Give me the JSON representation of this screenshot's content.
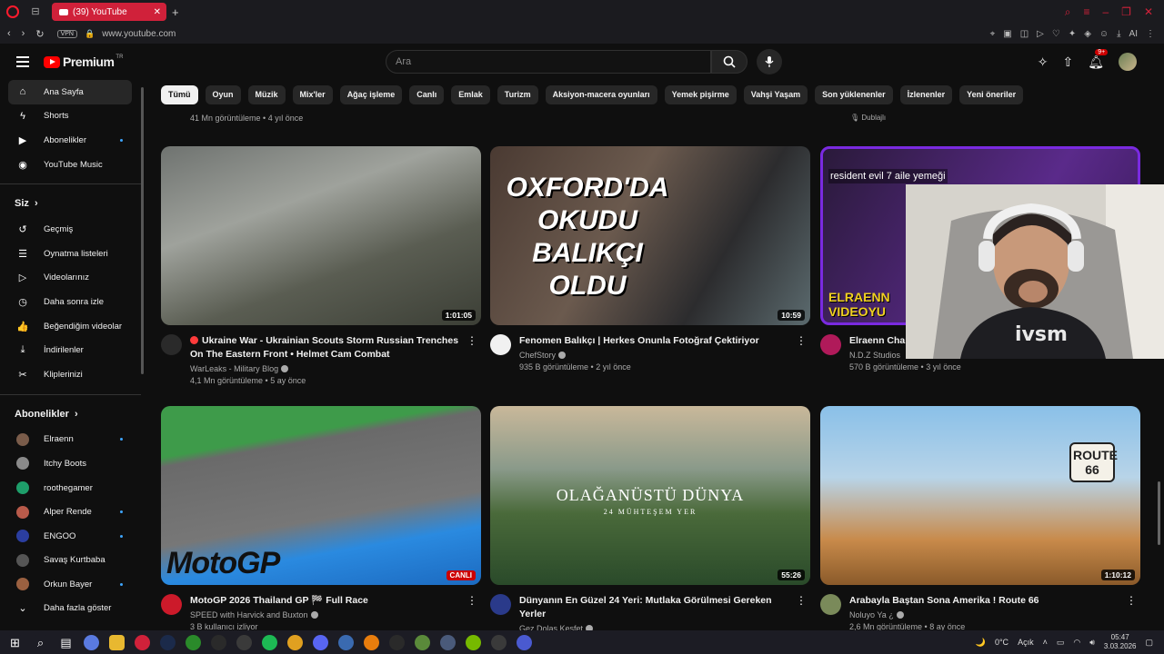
{
  "browser": {
    "tab_title": "(39) YouTube",
    "url": "www.youtube.com",
    "vpn_label": "VPN",
    "ai_label": "AI"
  },
  "header": {
    "logo_text": "Premium",
    "logo_region": "TR",
    "search_placeholder": "Ara",
    "notification_count": "9+"
  },
  "sidebar": {
    "main_items": [
      {
        "label": "Ana Sayfa",
        "icon": "home-icon",
        "glyph": "⌂"
      },
      {
        "label": "Shorts",
        "icon": "shorts-icon",
        "glyph": "ϟ"
      },
      {
        "label": "Abonelikler",
        "icon": "subscriptions-icon",
        "glyph": "▶"
      },
      {
        "label": "YouTube Music",
        "icon": "music-icon",
        "glyph": "◉"
      }
    ],
    "you_heading": "Siz",
    "you_items": [
      {
        "label": "Geçmiş",
        "icon": "history-icon",
        "glyph": "↺"
      },
      {
        "label": "Oynatma listeleri",
        "icon": "playlists-icon",
        "glyph": "☰"
      },
      {
        "label": "Videolarınız",
        "icon": "your-videos-icon",
        "glyph": "▷"
      },
      {
        "label": "Daha sonra izle",
        "icon": "watch-later-icon",
        "glyph": "◷"
      },
      {
        "label": "Beğendiğim videolar",
        "icon": "liked-icon",
        "glyph": "👍"
      },
      {
        "label": "İndirilenler",
        "icon": "downloads-icon",
        "glyph": "⤓"
      },
      {
        "label": "Kliplerinizi",
        "icon": "clips-icon",
        "glyph": "✂"
      }
    ],
    "subs_heading": "Abonelikler",
    "channels": [
      {
        "name": "Elraenn",
        "color": "#7a5c4a",
        "dot": true
      },
      {
        "name": "Itchy Boots",
        "color": "#8a8a8a",
        "dot": false
      },
      {
        "name": "roothegamer",
        "color": "#1e9e6a",
        "dot": false
      },
      {
        "name": "Alper Rende",
        "color": "#b85a4a",
        "dot": true
      },
      {
        "name": "ENGOO",
        "color": "#2b3ea0",
        "dot": true
      },
      {
        "name": "Savaş Kurtbaba",
        "color": "#555555",
        "dot": false
      },
      {
        "name": "Orkun Bayer",
        "color": "#9a6040",
        "dot": true
      }
    ],
    "show_more": "Daha fazla göster"
  },
  "chips": [
    "Tümü",
    "Oyun",
    "Müzik",
    "Mix'ler",
    "Ağaç işleme",
    "Canlı",
    "Emlak",
    "Turizm",
    "Aksiyon-macera oyunları",
    "Yemek pişirme",
    "Vahşi Yaşam",
    "Son yüklenenler",
    "İzlenenler",
    "Yeni öneriler"
  ],
  "previous_row": {
    "meta": "41 Mn görüntüleme • 4 yıl önce",
    "dubbed": "Dublajlı"
  },
  "videos": [
    {
      "title": "Ukraine War - Ukrainian Scouts Storm Russian Trenches On The Eastern Front • Helmet Cam Combat",
      "channel": "WarLeaks - Military Blog",
      "meta": "4,1 Mn görüntüleme • 5 ay önce",
      "duration": "1:01:05",
      "thumb_bg": "linear-gradient(160deg,#6f7370 0%,#9fa29c 35%,#5a5d52 65%,#3c3f36 100%)",
      "icon_color": "#2a2a2a"
    },
    {
      "title": "Fenomen Balıkçı | Herkes Onunla Fotoğraf Çektiriyor",
      "channel": "ChefStory",
      "meta": "935 B görüntüleme • 2 yıl önce",
      "duration": "10:59",
      "thumb_bg": "linear-gradient(120deg,#4a3a32 0%,#6b5a4e 40%,#2c2c2e 70%,#5b6a6e 100%)",
      "thumb_text": "OXFORD'DA OKUDU BALIKÇI OLDU",
      "icon_color": "#f1f1f1"
    },
    {
      "title": "Elraenn Charlie Kesmesi ve Resident Evil 7 İzliyor | Cordy",
      "channel": "N.D.Z Studios",
      "meta": "570 B görüntüleme • 3 yıl önce",
      "thumb_bg": "linear-gradient(120deg,#2a1a3a 0%,#5a2a8a 60%,#3a1a5a 100%)",
      "thumb_text": "resident evil 7 aile yemeği",
      "thumb_text2": "ELRAENN VIDEOYU",
      "icon_color": "#b01a5a"
    },
    {
      "title": "MotoGP 2026 Thailand GP 🏁 Full Race",
      "channel": "SPEED with Harvick and Buxton",
      "meta": "3 B kullanıcı izliyor",
      "live": "CANLI",
      "thumb_bg": "linear-gradient(170deg,#3e9b4a 0%,#3e9b4a 22%,#6a6a6a 26%,#777 60%,#2a8ae0 75%,#1c6ac0 100%)",
      "thumb_text": "MotoGP",
      "icon_color": "#cc1a2a"
    },
    {
      "title": "Dünyanın En Güzel 24 Yeri: Mutlaka Görülmesi Gereken Yerler",
      "channel": "Gez Dolaş Keşfet",
      "meta": "925 B görüntüleme • 4 ay önce",
      "duration": "55:26",
      "thumb_bg": "linear-gradient(180deg,#c9b89a 0%,#8a9a8a 35%,#4a6a3a 60%,#2a4a2a 100%)",
      "thumb_text": "OLAĞANÜSTÜ DÜNYA",
      "thumb_text2": "24 MÜHTEŞEM YER",
      "icon_color": "#2a3a8a"
    },
    {
      "title": "Arabayla Baştan Sona Amerika ! Route 66",
      "channel": "Noluyo Ya ¿",
      "meta": "2,6 Mn görüntüleme • 8 ay önce",
      "duration": "1:10:12",
      "thumb_bg": "linear-gradient(180deg,#8ac0e8 0%,#b8d4e8 40%,#c88a4a 75%,#8a5a2a 100%)",
      "thumb_text": "ROUTE 66",
      "icon_color": "#7a8a5a"
    }
  ],
  "webcam_text": "ivsm",
  "taskbar": {
    "weather": "0°C",
    "weather_label": "Açık",
    "time": "05:47",
    "date": "3.03.2026"
  }
}
